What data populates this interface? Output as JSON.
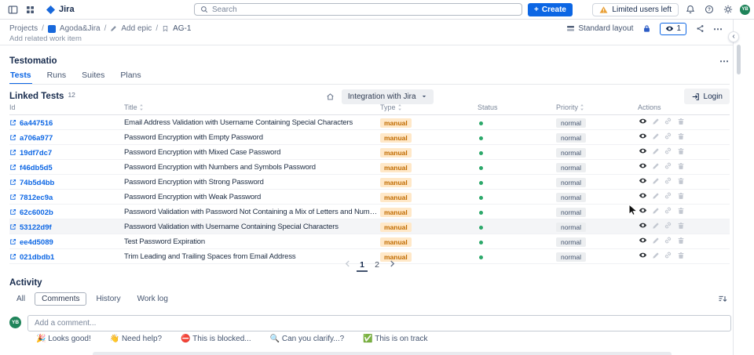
{
  "navbar": {
    "app_name": "Jira",
    "search_placeholder": "Search",
    "create_label": "Create",
    "limited_users_label": "Limited users left",
    "avatar_initials": "YB"
  },
  "breadcrumb": {
    "projects_label": "Projects",
    "separator": "/",
    "project_name": "Agoda&Jira",
    "add_epic_label": "Add epic",
    "issue_key": "AG-1"
  },
  "toolbar": {
    "layout_label": "Standard layout",
    "watch_count": "1"
  },
  "page": {
    "add_related_label": "Add related work item"
  },
  "testomatio": {
    "title": "Testomatio",
    "tabs": [
      "Tests",
      "Runs",
      "Suites",
      "Plans"
    ],
    "active_tab": "Tests",
    "linked_tests_label": "Linked Tests",
    "linked_tests_count": "12",
    "integration_dropdown_label": "Integration with Jira",
    "login_label": "Login",
    "table": {
      "columns": [
        {
          "label": "Id",
          "sortable": false
        },
        {
          "label": "Title",
          "sortable": true
        },
        {
          "label": "Type",
          "sortable": true
        },
        {
          "label": "Status",
          "sortable": false
        },
        {
          "label": "Priority",
          "sortable": true
        },
        {
          "label": "Actions",
          "sortable": false
        }
      ],
      "action_icons": [
        "view",
        "edit",
        "link",
        "delete"
      ],
      "highlighted_row": "53122d9f",
      "rows": [
        {
          "id": "6a447516",
          "title": "Email Address Validation with Username Containing Special Characters",
          "type": "manual",
          "status": "green",
          "priority": "normal"
        },
        {
          "id": "a706a977",
          "title": "Password Encryption with Empty Password",
          "type": "manual",
          "status": "green",
          "priority": "normal"
        },
        {
          "id": "19df7dc7",
          "title": "Password Encryption with Mixed Case Password",
          "type": "manual",
          "status": "green",
          "priority": "normal"
        },
        {
          "id": "f46db5d5",
          "title": "Password Encryption with Numbers and Symbols Password",
          "type": "manual",
          "status": "green",
          "priority": "normal"
        },
        {
          "id": "74b5d4bb",
          "title": "Password Encryption with Strong Password",
          "type": "manual",
          "status": "green",
          "priority": "normal"
        },
        {
          "id": "7812ec9a",
          "title": "Password Encryption with Weak Password",
          "type": "manual",
          "status": "green",
          "priority": "normal"
        },
        {
          "id": "62c6002b",
          "title": "Password Validation with Password Not Containing a Mix of Letters and Numbers",
          "type": "manual",
          "status": "green",
          "priority": "normal"
        },
        {
          "id": "53122d9f",
          "title": "Password Validation with Username Containing Special Characters",
          "type": "manual",
          "status": "green",
          "priority": "normal"
        },
        {
          "id": "ee4d5089",
          "title": "Test Password Expiration",
          "type": "manual",
          "status": "green",
          "priority": "normal"
        },
        {
          "id": "021dbdb1",
          "title": "Trim Leading and Trailing Spaces from Email Address",
          "type": "manual",
          "status": "green",
          "priority": "normal"
        }
      ]
    },
    "pagination": {
      "pages": [
        "1",
        "2"
      ],
      "current": "1"
    }
  },
  "activity": {
    "title": "Activity",
    "tabs": [
      "All",
      "Comments",
      "History",
      "Work log"
    ],
    "active_tab": "Comments",
    "avatar_initials": "YB",
    "comment_placeholder": "Add a comment...",
    "quick_replies": [
      "🎉 Looks good!",
      "👋 Need help?",
      "⛔ This is blocked...",
      "🔍 Can you clarify...?",
      "✅ This is on track"
    ]
  },
  "icons_unicode": {
    "more": "⋯",
    "plus": "+",
    "panel_collapse": "‹"
  },
  "colors": {
    "accent_blue": "#0c66e4",
    "manual_badge_bg": "#ffe8c8",
    "manual_badge_text": "#c06b00",
    "priority_badge_bg": "#eceef0",
    "priority_badge_text": "#44546f",
    "status_green": "#2ca86a",
    "avatar_green": "#1f845a",
    "warning_yellow": "#e9a23b"
  }
}
